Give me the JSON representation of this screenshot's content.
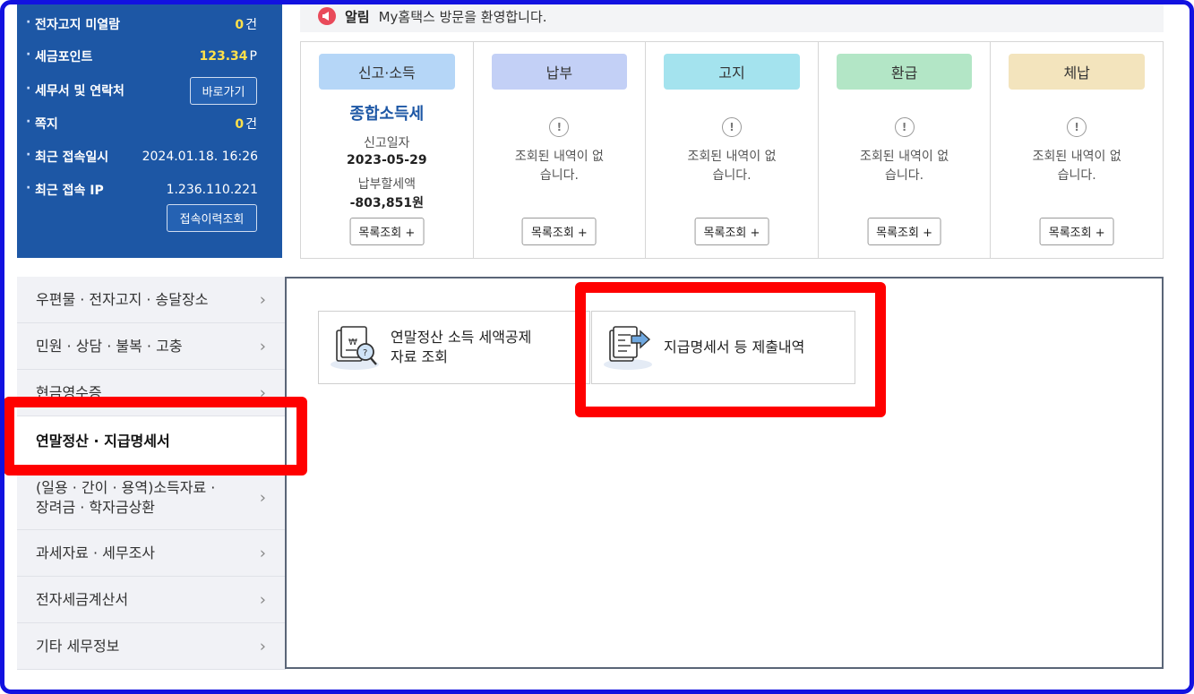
{
  "info": {
    "unread_notice_label": "전자고지 미열람",
    "unread_notice_count": "0",
    "unread_notice_unit": "건",
    "tax_point_label": "세금포인트",
    "tax_point_value": "123.34",
    "tax_point_unit": "P",
    "agent_label": "세무서 및 연락처",
    "agent_button": "바로가기",
    "memo_label": "쪽지",
    "memo_count": "0",
    "memo_unit": "건",
    "last_login_label": "최근 접속일시",
    "last_login_value": "2024.01.18.  16:26",
    "last_ip_label": "최근 접속 IP",
    "last_ip_value": "1.236.110.221",
    "history_button": "접속이력조회"
  },
  "notice": {
    "icon": "megaphone-icon",
    "tag": "알림",
    "message": "My홈택스 방문을 환영합니다."
  },
  "cards": [
    {
      "head": "신고·소득",
      "color": "#b5d6f7",
      "title": "종합소득세",
      "date_label": "신고일자",
      "date_value": "2023-05-29",
      "amount_label": "납부할세액",
      "amount_value": "-803,851원",
      "button": "목록조회 +"
    },
    {
      "head": "납부",
      "color": "#c3d0f6",
      "empty": "조회된 내역이 없습니다.",
      "button": "목록조회 +"
    },
    {
      "head": "고지",
      "color": "#a4e3ee",
      "empty": "조회된 내역이 없습니다.",
      "button": "목록조회 +"
    },
    {
      "head": "환급",
      "color": "#b3e6c6",
      "empty": "조회된 내역이 없습니다.",
      "button": "목록조회 +"
    },
    {
      "head": "체납",
      "color": "#f3e4bd",
      "empty": "조회된 내역이 없습니다.",
      "button": "목록조회 +"
    }
  ],
  "menu": [
    {
      "label": "우편물 · 전자고지 · 송달장소"
    },
    {
      "label": "민원 · 상담 · 불복 · 고충"
    },
    {
      "label": "현금영수증"
    },
    {
      "label": "연말정산 · 지급명세서",
      "active": true
    },
    {
      "label_line1": "(일용 · 간이 · 용역)소득자료 ·",
      "label_line2": "장려금 · 학자금상환"
    },
    {
      "label": "과세자료 · 세무조사"
    },
    {
      "label": "전자세금계산서"
    },
    {
      "label": "기타 세무정보"
    }
  ],
  "tiles": [
    {
      "line1": "연말정산 소득 세액공제",
      "line2": "자료 조회",
      "icon": "document-search-icon"
    },
    {
      "line1": "지급명세서 등 제출내역",
      "icon": "document-submit-icon"
    }
  ],
  "chevron": "›",
  "alert_glyph": "!"
}
